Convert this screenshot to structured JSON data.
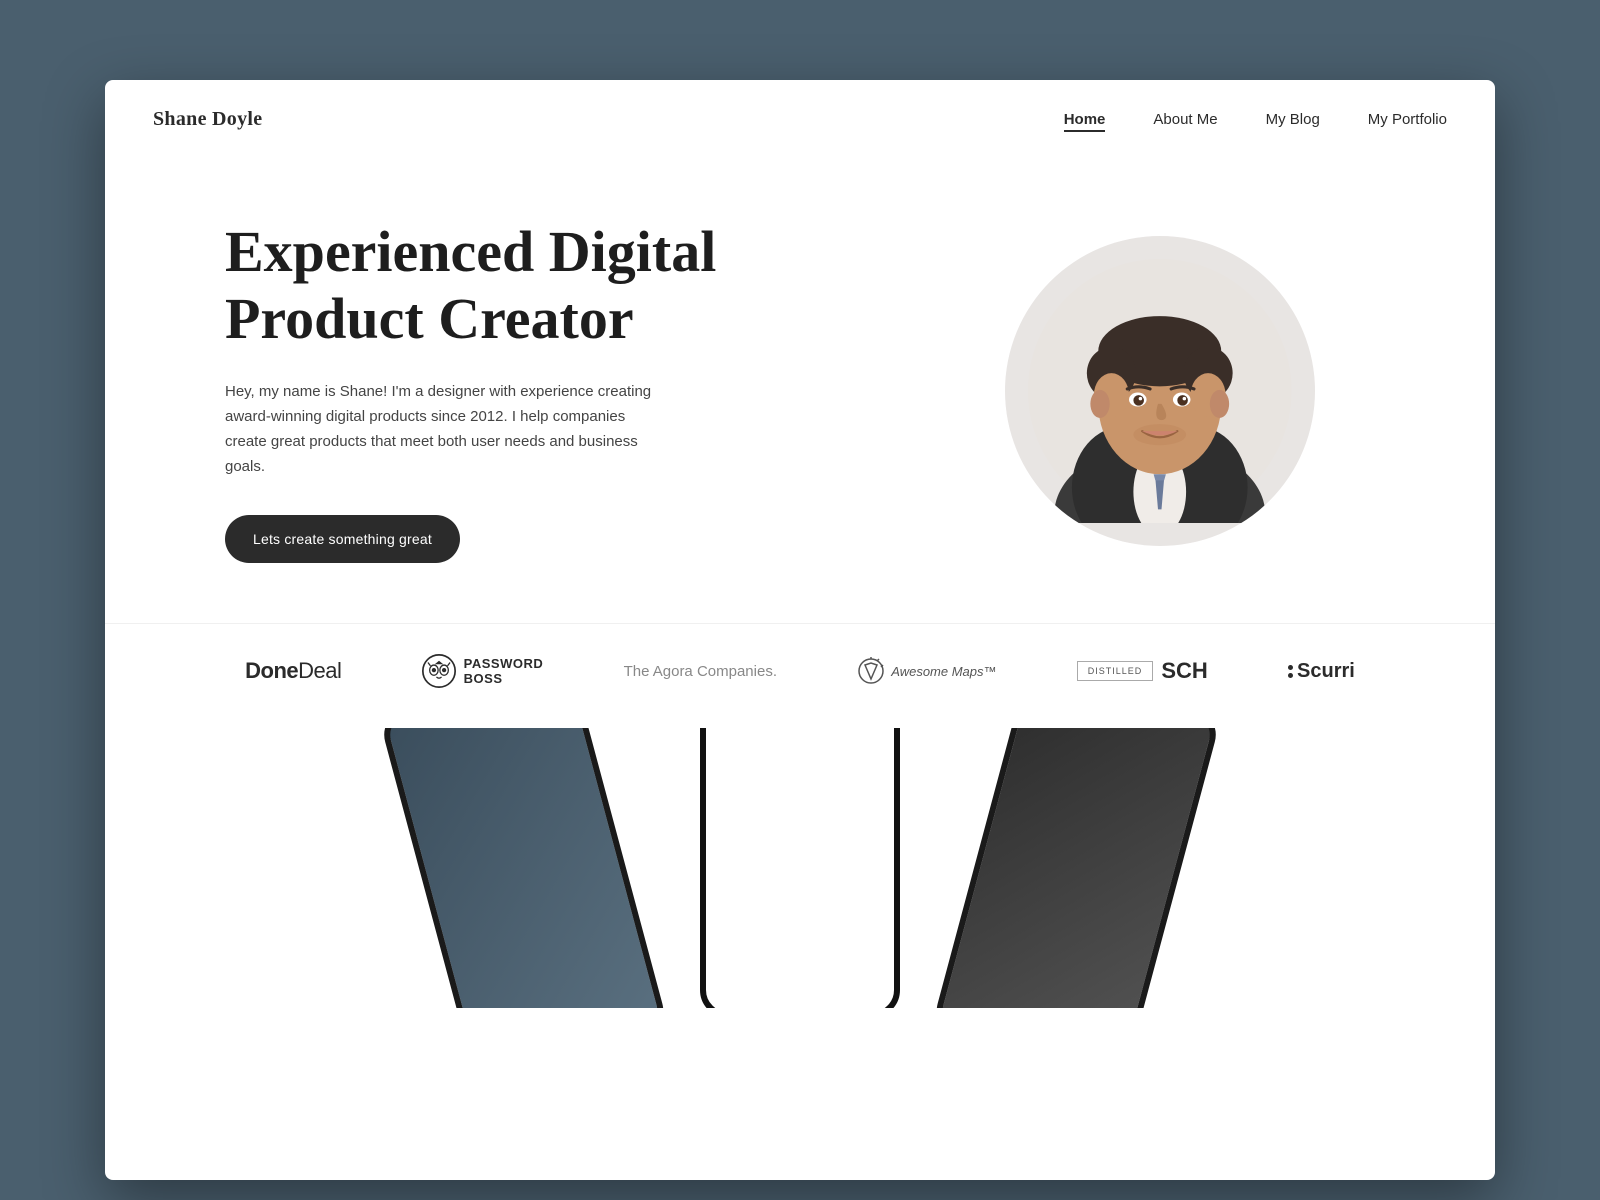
{
  "site": {
    "logo": "Shane Doyle",
    "nav": {
      "items": [
        {
          "label": "Home",
          "active": true
        },
        {
          "label": "About Me",
          "active": false
        },
        {
          "label": "My Blog",
          "active": false
        },
        {
          "label": "My Portfolio",
          "active": false
        }
      ]
    }
  },
  "hero": {
    "title": "Experienced Digital Product Creator",
    "description": "Hey, my name is Shane! I'm a designer with experience creating award-winning digital products since 2012. I help companies create great products that meet both user needs and business goals.",
    "cta_label": "Lets create something great"
  },
  "logos": [
    {
      "id": "donedeal",
      "text": "DoneDeal"
    },
    {
      "id": "passwordboss",
      "text": "PASSWORD\nBOSS"
    },
    {
      "id": "agora",
      "text": "The Agora Companies."
    },
    {
      "id": "awesomemaps",
      "text": "Awesome Maps™"
    },
    {
      "id": "distilled",
      "text": "DISTILLED SCH"
    },
    {
      "id": "scurri",
      "text": "Scurri"
    }
  ],
  "phones": {
    "count": 3
  }
}
